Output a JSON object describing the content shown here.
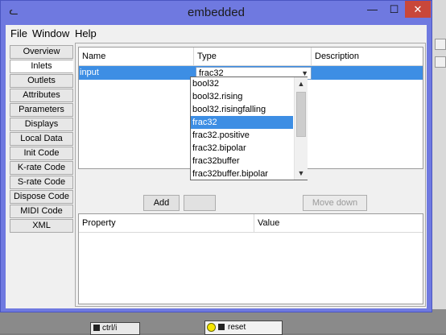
{
  "window": {
    "title": "embedded",
    "app_icon": "cat-icon",
    "controls": {
      "minimize": "—",
      "maximize": "☐",
      "close": "✕"
    }
  },
  "menubar": {
    "items": [
      "File",
      "Window",
      "Help"
    ]
  },
  "tabs": {
    "items": [
      "Overview",
      "Inlets",
      "Outlets",
      "Attributes",
      "Parameters",
      "Displays",
      "Local Data",
      "Init Code",
      "K-rate Code",
      "S-rate Code",
      "Dispose Code",
      "MIDI Code",
      "XML"
    ],
    "selected": "Inlets"
  },
  "inlet_table": {
    "columns": [
      "Name",
      "Type",
      "Description"
    ],
    "rows": [
      {
        "name": "input",
        "type": "frac32",
        "description": ""
      }
    ]
  },
  "type_dropdown": {
    "options": [
      "bool32",
      "bool32.rising",
      "bool32.risingfalling",
      "frac32",
      "frac32.positive",
      "frac32.bipolar",
      "frac32buffer",
      "frac32buffer.bipolar"
    ],
    "selected": "frac32",
    "scroll_up": "▲",
    "scroll_down": "▼",
    "combo_arrow": "▼"
  },
  "buttons": {
    "add": "Add",
    "remove": "",
    "move_down": "Move down"
  },
  "property_table": {
    "columns": [
      "Property",
      "Value"
    ]
  },
  "background": {
    "object_label": "ctrl/i",
    "reset_label": "reset"
  },
  "colors": {
    "selection": "#3d8ee4",
    "titlebar": "#6f79e0",
    "close": "#c9473a"
  }
}
